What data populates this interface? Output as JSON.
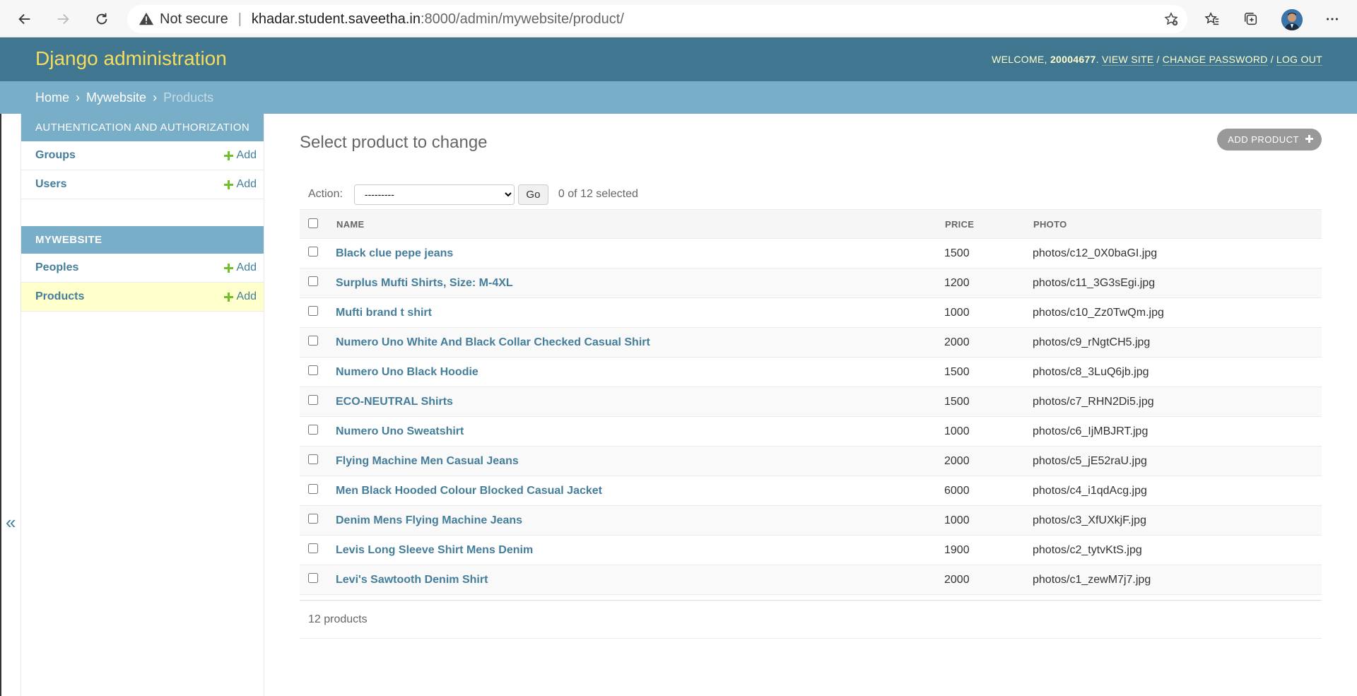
{
  "browser": {
    "not_secure": "Not secure",
    "url_host": "khadar.student.saveetha.in",
    "url_rest": ":8000/admin/mywebsite/product/"
  },
  "header": {
    "branding": "Django administration",
    "welcome": "Welcome,",
    "username": "20004677",
    "view_site": "View site",
    "change_password": "Change password",
    "log_out": "Log out"
  },
  "breadcrumbs": {
    "home": "Home",
    "app": "Mywebsite",
    "current": "Products",
    "separator": "›"
  },
  "sidebar": {
    "toggle": "«",
    "apps": [
      {
        "caption": "Authentication and Authorization",
        "models": [
          {
            "label": "Groups",
            "add": "Add"
          },
          {
            "label": "Users",
            "add": "Add"
          }
        ]
      },
      {
        "caption": "Mywebsite",
        "models": [
          {
            "label": "Peoples",
            "add": "Add"
          },
          {
            "label": "Products",
            "add": "Add"
          }
        ]
      }
    ]
  },
  "content": {
    "title": "Select product to change",
    "add_button": "Add product",
    "action_label": "Action:",
    "action_selected": "---------",
    "go": "Go",
    "counter": "0 of 12 selected",
    "columns": {
      "name": "Name",
      "price": "Price",
      "photo": "Photo"
    },
    "rows": [
      {
        "name": "Black clue pepe jeans",
        "price": "1500",
        "photo": "photos/c12_0X0baGI.jpg"
      },
      {
        "name": "Surplus Mufti Shirts, Size: M-4XL",
        "price": "1200",
        "photo": "photos/c11_3G3sEgi.jpg"
      },
      {
        "name": "Mufti brand t shirt",
        "price": "1000",
        "photo": "photos/c10_Zz0TwQm.jpg"
      },
      {
        "name": "Numero Uno White And Black Collar Checked Casual Shirt",
        "price": "2000",
        "photo": "photos/c9_rNgtCH5.jpg"
      },
      {
        "name": "Numero Uno Black Hoodie",
        "price": "1500",
        "photo": "photos/c8_3LuQ6jb.jpg"
      },
      {
        "name": "ECO-NEUTRAL Shirts",
        "price": "1500",
        "photo": "photos/c7_RHN2Di5.jpg"
      },
      {
        "name": "Numero Uno Sweatshirt",
        "price": "1000",
        "photo": "photos/c6_IjMBJRT.jpg"
      },
      {
        "name": "Flying Machine Men Casual Jeans",
        "price": "2000",
        "photo": "photos/c5_jE52raU.jpg"
      },
      {
        "name": "Men Black Hooded Colour Blocked Casual Jacket",
        "price": "6000",
        "photo": "photos/c4_i1qdAcg.jpg"
      },
      {
        "name": "Denim Mens Flying Machine Jeans",
        "price": "1000",
        "photo": "photos/c3_XfUXkjF.jpg"
      },
      {
        "name": "Levis Long Sleeve Shirt Mens Denim",
        "price": "1900",
        "photo": "photos/c2_tytvKtS.jpg"
      },
      {
        "name": "Levi's Sawtooth Denim Shirt",
        "price": "2000",
        "photo": "photos/c1_zewM7j7.jpg"
      }
    ],
    "paginator": "12 products"
  },
  "colors": {
    "header_bg": "#417690",
    "branding": "#f5dd5d",
    "breadcrumb_bg": "#79aec8",
    "link": "#447e9b",
    "add_green": "#70bf2b",
    "selected_row": "#ffffcc"
  },
  "icons": [
    "back-arrow-icon",
    "forward-arrow-icon",
    "refresh-icon",
    "warning-icon",
    "favorite-add-icon",
    "favorites-icon",
    "collections-icon",
    "more-icon",
    "plus-icon"
  ]
}
